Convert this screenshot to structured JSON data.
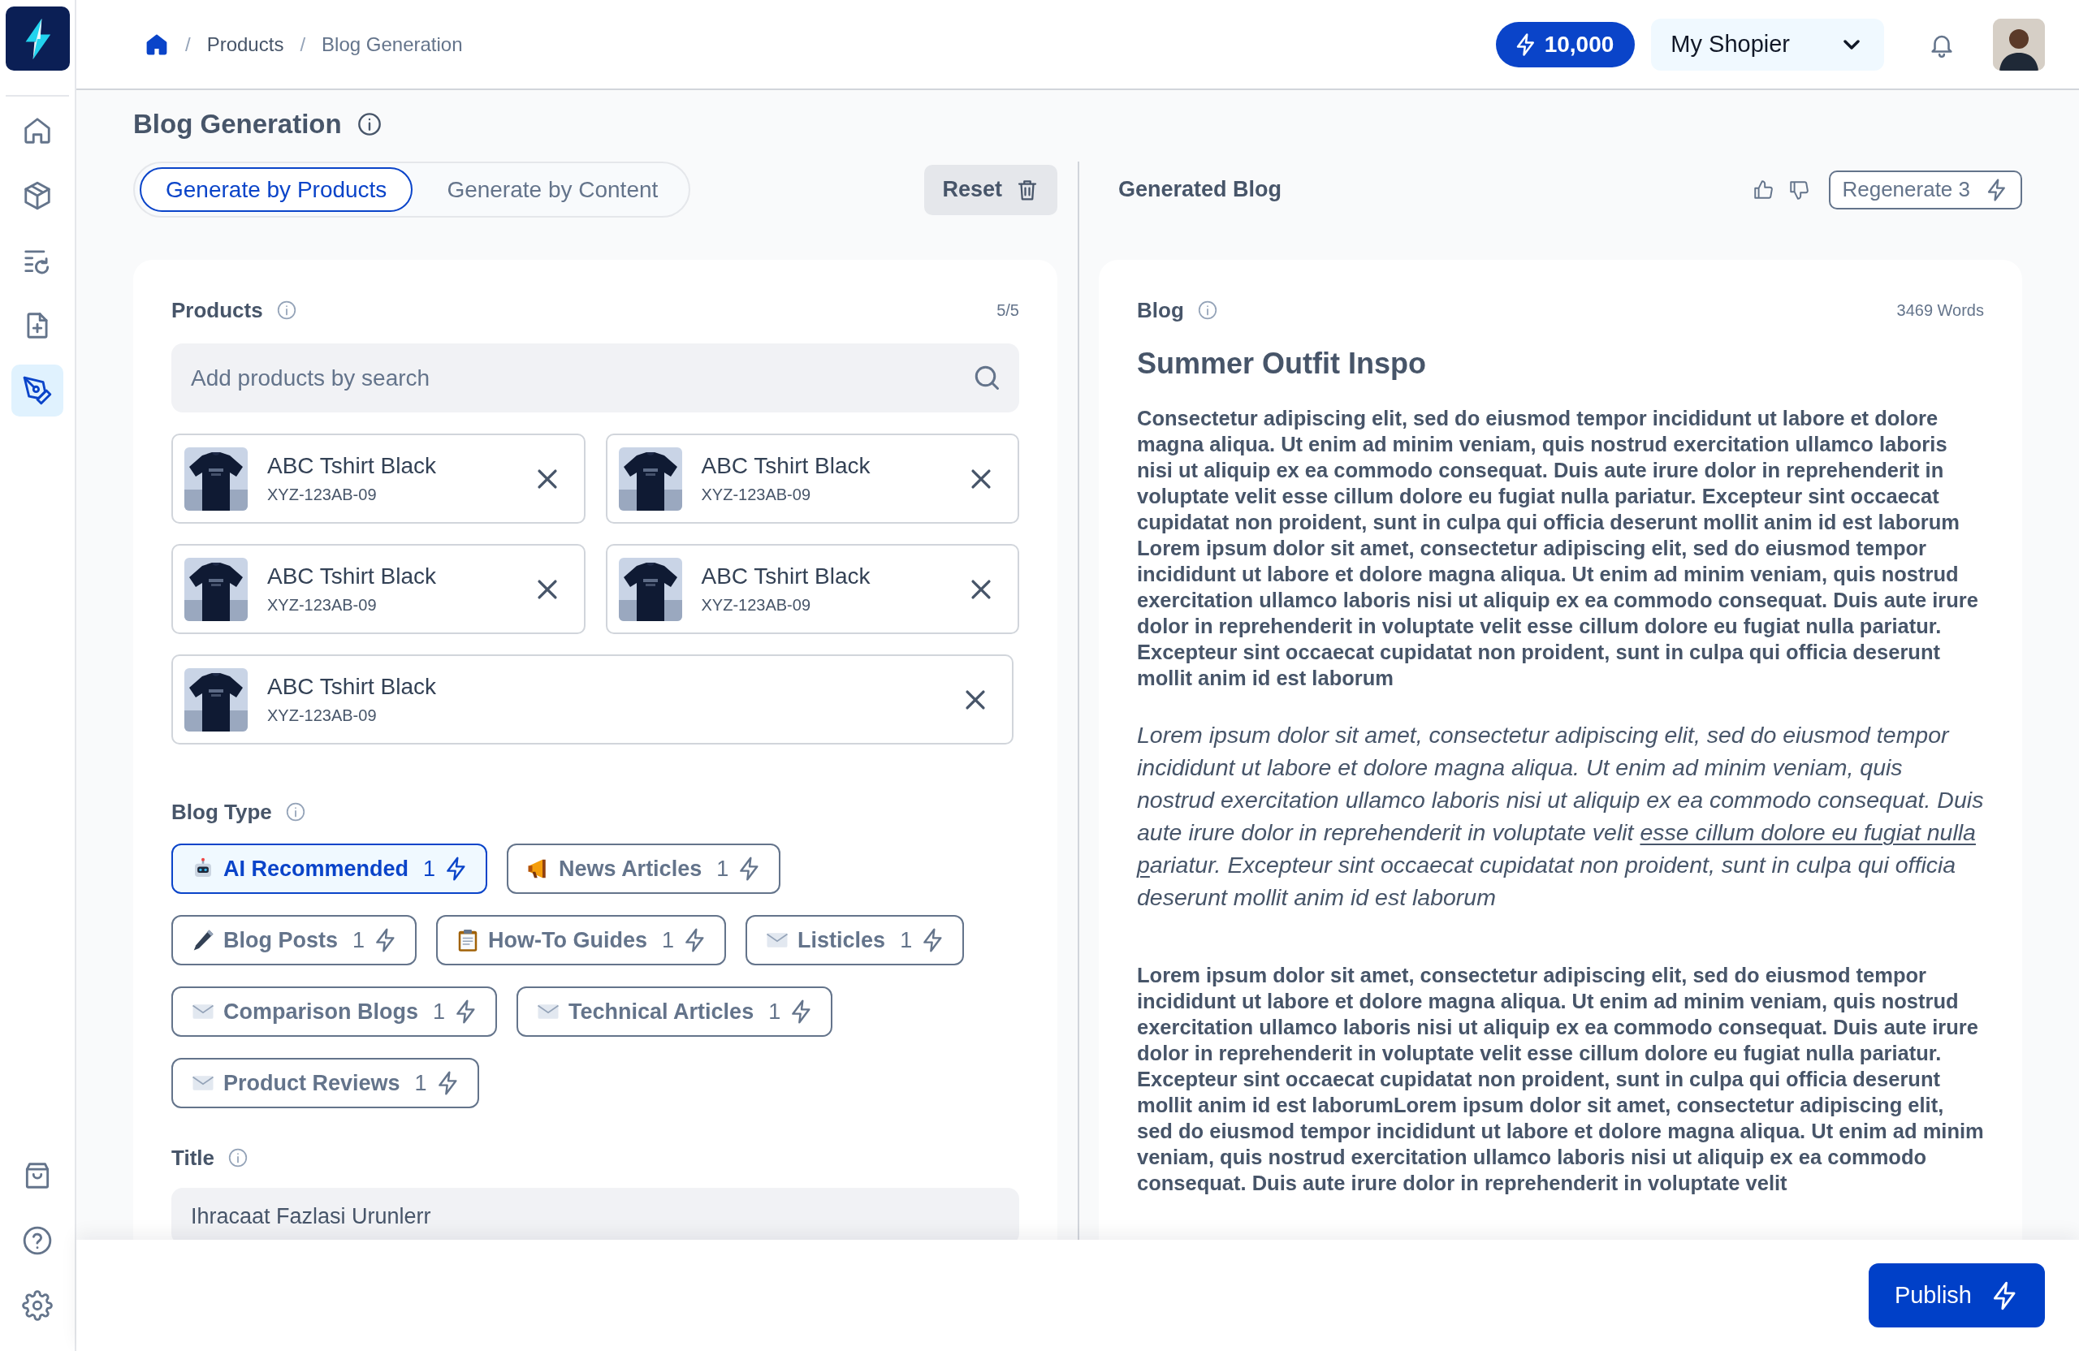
{
  "sidebar": {
    "top_items": [
      {
        "kind": "home",
        "selected": false
      },
      {
        "kind": "cube",
        "selected": false
      },
      {
        "kind": "list",
        "selected": false
      },
      {
        "kind": "file",
        "selected": false
      },
      {
        "kind": "pen",
        "selected": true
      }
    ],
    "bottom_items": [
      {
        "kind": "bag",
        "selected": false
      },
      {
        "kind": "help",
        "selected": false
      },
      {
        "kind": "settings",
        "selected": false
      }
    ]
  },
  "breadcrumb": [
    {
      "separator": "/",
      "label": "Products"
    },
    {
      "separator": "/",
      "label": "Blog Generation"
    }
  ],
  "header": {
    "credits": "10,000",
    "shop": "My Shopier"
  },
  "page_title": "Blog Generation",
  "mode_tabs": [
    {
      "label": "Generate by Products",
      "selected": true
    },
    {
      "label": "Generate by Content",
      "selected": false
    }
  ],
  "reset_button": "Reset",
  "products": {
    "label": "Products",
    "count": "5/5",
    "search": {
      "placeholder": "Add products by search"
    },
    "items": [
      {
        "name": "ABC Tshirt Black",
        "sku": "XYZ-123AB-09"
      },
      {
        "name": "ABC Tshirt Black",
        "sku": "XYZ-123AB-09"
      },
      {
        "name": "ABC Tshirt Black",
        "sku": "XYZ-123AB-09"
      },
      {
        "name": "ABC Tshirt Black",
        "sku": "XYZ-123AB-09"
      },
      {
        "name": "ABC Tshirt Black",
        "sku": "XYZ-123AB-09"
      }
    ]
  },
  "blog_type": {
    "label": "Blog Type",
    "options": [
      {
        "label": "AI Recommended",
        "count": "1",
        "kind": "robot",
        "selected": true
      },
      {
        "label": "News Articles",
        "count": "1",
        "kind": "megaphone",
        "selected": false
      },
      {
        "label": "Blog Posts",
        "count": "1",
        "kind": "pen",
        "selected": false
      },
      {
        "label": "How-To Guides",
        "count": "1",
        "kind": "clipboard",
        "selected": false
      },
      {
        "label": "Listicles",
        "count": "1",
        "kind": "envelope",
        "selected": false
      },
      {
        "label": "Comparison Blogs",
        "count": "1",
        "kind": "envelope",
        "selected": false
      },
      {
        "label": "Technical Articles",
        "count": "1",
        "kind": "envelope",
        "selected": false
      },
      {
        "label": "Product Reviews",
        "count": "1",
        "kind": "envelope",
        "selected": false
      }
    ]
  },
  "title_field": {
    "label": "Title",
    "value": "Ihracaat Fazlasi Urunlerr"
  },
  "generated_blog": {
    "heading": "Generated Blog",
    "regenerate": "Regenerate 3",
    "blog_label": "Blog",
    "word_count": "3469 Words",
    "title": "Summer Outfit Inspo",
    "paragraphs": [
      {
        "kind": "bold",
        "segments": [
          {
            "text": "Consectetur adipiscing elit, sed do eiusmod tempor incididunt ut labore et dolore magna aliqua. Ut enim ad minim veniam, quis nostrud exercitation ullamco laboris nisi ut aliquip ex ea commodo consequat. Duis aute irure dolor in reprehenderit in voluptate velit esse cillum dolore eu fugiat nulla pariatur. Excepteur sint occaecat cupidatat non proident, sunt in culpa qui officia deserunt mollit anim id est laborum Lorem ipsum dolor sit amet, consectetur adipiscing elit, sed do eiusmod tempor incididunt ut labore et dolore magna aliqua. Ut enim ad minim veniam, quis nostrud exercitation ullamco laboris nisi ut aliquip ex ea commodo consequat. Duis aute irure dolor in reprehenderit in voluptate velit esse cillum dolore eu fugiat nulla pariatur. Excepteur sint occaecat cupidatat non proident, sunt in culpa qui officia deserunt mollit anim id est laborum",
            "underline": false
          }
        ]
      },
      {
        "kind": "italic",
        "segments": [
          {
            "text": "Lorem ipsum dolor sit amet, consectetur adipiscing elit, sed do eiusmod tempor incididunt ut labore et dolore magna aliqua. Ut enim ad minim veniam, quis nostrud exercitation ullamco laboris nisi ut aliquip ex ea commodo consequat. Duis aute irure dolor in reprehenderit in voluptate velit ",
            "underline": false
          },
          {
            "text": "esse cillum dolore eu fugiat nulla p",
            "underline": true
          },
          {
            "text": "ariatur. Excepteur sint occaecat cupidatat non proident, sunt in culpa qui officia deserunt mollit anim id est laborum",
            "underline": false
          }
        ]
      },
      {
        "kind": "bold",
        "segments": [
          {
            "text": "Lorem ipsum dolor sit amet, consectetur adipiscing elit, sed do eiusmod tempor incididunt ut labore et dolore magna aliqua. Ut enim ad minim veniam, quis nostrud exercitation ullamco laboris nisi ut aliquip ex ea commodo consequat. Duis aute irure dolor in reprehenderit in voluptate velit esse cillum dolore eu fugiat nulla pariatur. Excepteur sint occaecat cupidatat non proident, sunt in culpa qui officia deserunt mollit anim id est laborumLorem ipsum dolor sit amet, consectetur adipiscing elit, sed do eiusmod tempor incididunt ut labore et dolore magna aliqua. Ut enim ad minim veniam, quis nostrud exercitation ullamco laboris nisi ut aliquip ex ea commodo consequat. Duis aute irure dolor in reprehenderit in voluptate velit",
            "underline": false
          }
        ]
      }
    ]
  },
  "footer": {
    "publish": "Publish"
  }
}
